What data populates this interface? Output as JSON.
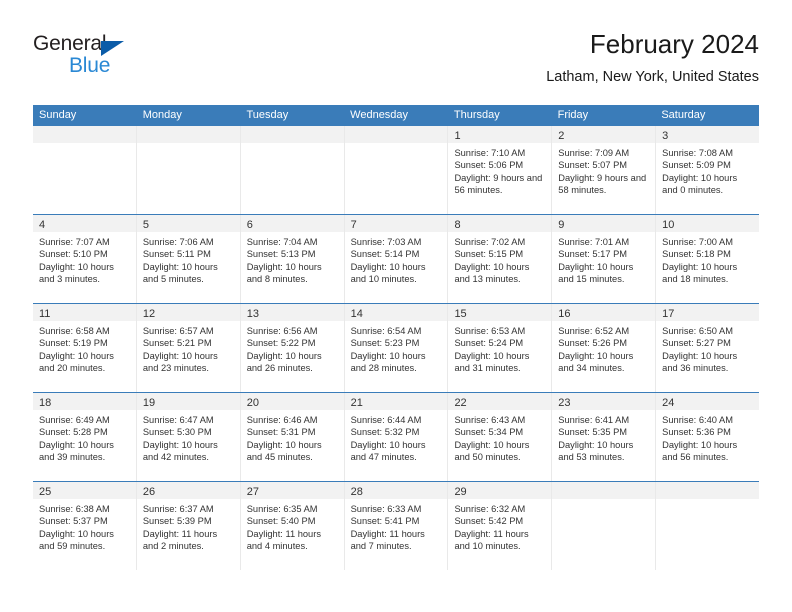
{
  "brand": {
    "name_part1": "General",
    "name_part2": "Blue",
    "triangle_color": "#0b5ca8",
    "blue_color": "#2a88d4"
  },
  "header": {
    "title": "February 2024",
    "subtitle": "Latham, New York, United States"
  },
  "theme": {
    "header_blue": "#3a7cb9",
    "daynum_band": "#f2f2f2",
    "text": "#333333"
  },
  "calendar": {
    "day_headers": [
      "Sunday",
      "Monday",
      "Tuesday",
      "Wednesday",
      "Thursday",
      "Friday",
      "Saturday"
    ],
    "weeks": [
      [
        {
          "day": "",
          "sunrise": "",
          "sunset": "",
          "daylight": "",
          "empty": true
        },
        {
          "day": "",
          "sunrise": "",
          "sunset": "",
          "daylight": "",
          "empty": true
        },
        {
          "day": "",
          "sunrise": "",
          "sunset": "",
          "daylight": "",
          "empty": true
        },
        {
          "day": "",
          "sunrise": "",
          "sunset": "",
          "daylight": "",
          "empty": true
        },
        {
          "day": "1",
          "sunrise": "Sunrise: 7:10 AM",
          "sunset": "Sunset: 5:06 PM",
          "daylight": "Daylight: 9 hours and 56 minutes."
        },
        {
          "day": "2",
          "sunrise": "Sunrise: 7:09 AM",
          "sunset": "Sunset: 5:07 PM",
          "daylight": "Daylight: 9 hours and 58 minutes."
        },
        {
          "day": "3",
          "sunrise": "Sunrise: 7:08 AM",
          "sunset": "Sunset: 5:09 PM",
          "daylight": "Daylight: 10 hours and 0 minutes."
        }
      ],
      [
        {
          "day": "4",
          "sunrise": "Sunrise: 7:07 AM",
          "sunset": "Sunset: 5:10 PM",
          "daylight": "Daylight: 10 hours and 3 minutes."
        },
        {
          "day": "5",
          "sunrise": "Sunrise: 7:06 AM",
          "sunset": "Sunset: 5:11 PM",
          "daylight": "Daylight: 10 hours and 5 minutes."
        },
        {
          "day": "6",
          "sunrise": "Sunrise: 7:04 AM",
          "sunset": "Sunset: 5:13 PM",
          "daylight": "Daylight: 10 hours and 8 minutes."
        },
        {
          "day": "7",
          "sunrise": "Sunrise: 7:03 AM",
          "sunset": "Sunset: 5:14 PM",
          "daylight": "Daylight: 10 hours and 10 minutes."
        },
        {
          "day": "8",
          "sunrise": "Sunrise: 7:02 AM",
          "sunset": "Sunset: 5:15 PM",
          "daylight": "Daylight: 10 hours and 13 minutes."
        },
        {
          "day": "9",
          "sunrise": "Sunrise: 7:01 AM",
          "sunset": "Sunset: 5:17 PM",
          "daylight": "Daylight: 10 hours and 15 minutes."
        },
        {
          "day": "10",
          "sunrise": "Sunrise: 7:00 AM",
          "sunset": "Sunset: 5:18 PM",
          "daylight": "Daylight: 10 hours and 18 minutes."
        }
      ],
      [
        {
          "day": "11",
          "sunrise": "Sunrise: 6:58 AM",
          "sunset": "Sunset: 5:19 PM",
          "daylight": "Daylight: 10 hours and 20 minutes."
        },
        {
          "day": "12",
          "sunrise": "Sunrise: 6:57 AM",
          "sunset": "Sunset: 5:21 PM",
          "daylight": "Daylight: 10 hours and 23 minutes."
        },
        {
          "day": "13",
          "sunrise": "Sunrise: 6:56 AM",
          "sunset": "Sunset: 5:22 PM",
          "daylight": "Daylight: 10 hours and 26 minutes."
        },
        {
          "day": "14",
          "sunrise": "Sunrise: 6:54 AM",
          "sunset": "Sunset: 5:23 PM",
          "daylight": "Daylight: 10 hours and 28 minutes."
        },
        {
          "day": "15",
          "sunrise": "Sunrise: 6:53 AM",
          "sunset": "Sunset: 5:24 PM",
          "daylight": "Daylight: 10 hours and 31 minutes."
        },
        {
          "day": "16",
          "sunrise": "Sunrise: 6:52 AM",
          "sunset": "Sunset: 5:26 PM",
          "daylight": "Daylight: 10 hours and 34 minutes."
        },
        {
          "day": "17",
          "sunrise": "Sunrise: 6:50 AM",
          "sunset": "Sunset: 5:27 PM",
          "daylight": "Daylight: 10 hours and 36 minutes."
        }
      ],
      [
        {
          "day": "18",
          "sunrise": "Sunrise: 6:49 AM",
          "sunset": "Sunset: 5:28 PM",
          "daylight": "Daylight: 10 hours and 39 minutes."
        },
        {
          "day": "19",
          "sunrise": "Sunrise: 6:47 AM",
          "sunset": "Sunset: 5:30 PM",
          "daylight": "Daylight: 10 hours and 42 minutes."
        },
        {
          "day": "20",
          "sunrise": "Sunrise: 6:46 AM",
          "sunset": "Sunset: 5:31 PM",
          "daylight": "Daylight: 10 hours and 45 minutes."
        },
        {
          "day": "21",
          "sunrise": "Sunrise: 6:44 AM",
          "sunset": "Sunset: 5:32 PM",
          "daylight": "Daylight: 10 hours and 47 minutes."
        },
        {
          "day": "22",
          "sunrise": "Sunrise: 6:43 AM",
          "sunset": "Sunset: 5:34 PM",
          "daylight": "Daylight: 10 hours and 50 minutes."
        },
        {
          "day": "23",
          "sunrise": "Sunrise: 6:41 AM",
          "sunset": "Sunset: 5:35 PM",
          "daylight": "Daylight: 10 hours and 53 minutes."
        },
        {
          "day": "24",
          "sunrise": "Sunrise: 6:40 AM",
          "sunset": "Sunset: 5:36 PM",
          "daylight": "Daylight: 10 hours and 56 minutes."
        }
      ],
      [
        {
          "day": "25",
          "sunrise": "Sunrise: 6:38 AM",
          "sunset": "Sunset: 5:37 PM",
          "daylight": "Daylight: 10 hours and 59 minutes."
        },
        {
          "day": "26",
          "sunrise": "Sunrise: 6:37 AM",
          "sunset": "Sunset: 5:39 PM",
          "daylight": "Daylight: 11 hours and 2 minutes."
        },
        {
          "day": "27",
          "sunrise": "Sunrise: 6:35 AM",
          "sunset": "Sunset: 5:40 PM",
          "daylight": "Daylight: 11 hours and 4 minutes."
        },
        {
          "day": "28",
          "sunrise": "Sunrise: 6:33 AM",
          "sunset": "Sunset: 5:41 PM",
          "daylight": "Daylight: 11 hours and 7 minutes."
        },
        {
          "day": "29",
          "sunrise": "Sunrise: 6:32 AM",
          "sunset": "Sunset: 5:42 PM",
          "daylight": "Daylight: 11 hours and 10 minutes."
        },
        {
          "day": "",
          "sunrise": "",
          "sunset": "",
          "daylight": "",
          "empty": true
        },
        {
          "day": "",
          "sunrise": "",
          "sunset": "",
          "daylight": "",
          "empty": true
        }
      ]
    ]
  }
}
